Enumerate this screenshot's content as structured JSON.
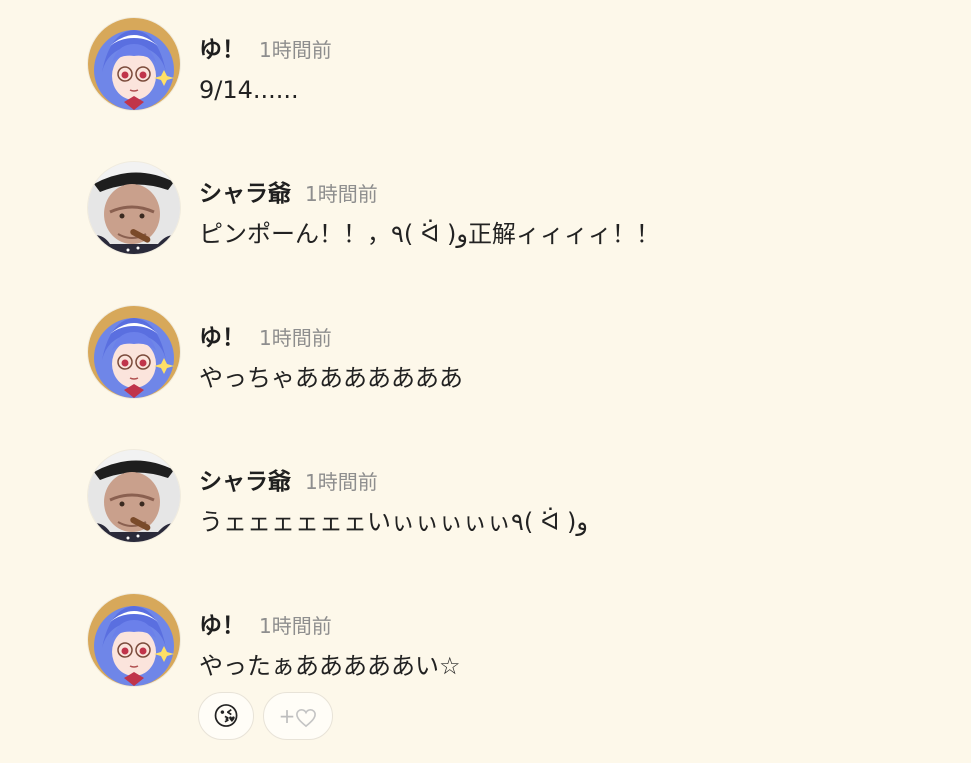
{
  "messages": [
    {
      "author": "ゆ！",
      "time": "1時間前",
      "text": "9/14......",
      "avatar_icon": "anime-girl-avatar-icon"
    },
    {
      "author": "シャラ爺",
      "time": "1時間前",
      "text": "ピンポーん！！，٩( ᐛ )و正解ィィィィ！！",
      "avatar_icon": "old-man-cigar-avatar-icon"
    },
    {
      "author": "ゆ！",
      "time": "1時間前",
      "text": "やっちゃあああああああ",
      "avatar_icon": "anime-girl-avatar-icon"
    },
    {
      "author": "シャラ爺",
      "time": "1時間前",
      "text": "うェェェェェェいぃぃぃぃぃ٩( ᐛ )و",
      "avatar_icon": "old-man-cigar-avatar-icon"
    },
    {
      "author": "ゆ！",
      "time": "1時間前",
      "text": "やったぁあああああい☆",
      "avatar_icon": "anime-girl-avatar-icon",
      "reactions": [
        {
          "emoji": "😘",
          "icon": "kissing-face-emoji"
        }
      ],
      "add_reaction_label": "+",
      "add_reaction_icon": "heart-outline-icon"
    }
  ],
  "colors": {
    "background": "#fdf8ea",
    "author_text": "#1f1f1f",
    "timestamp_text": "#8e8e8e",
    "message_text": "#222222",
    "reaction_border": "#e8e3d8"
  }
}
